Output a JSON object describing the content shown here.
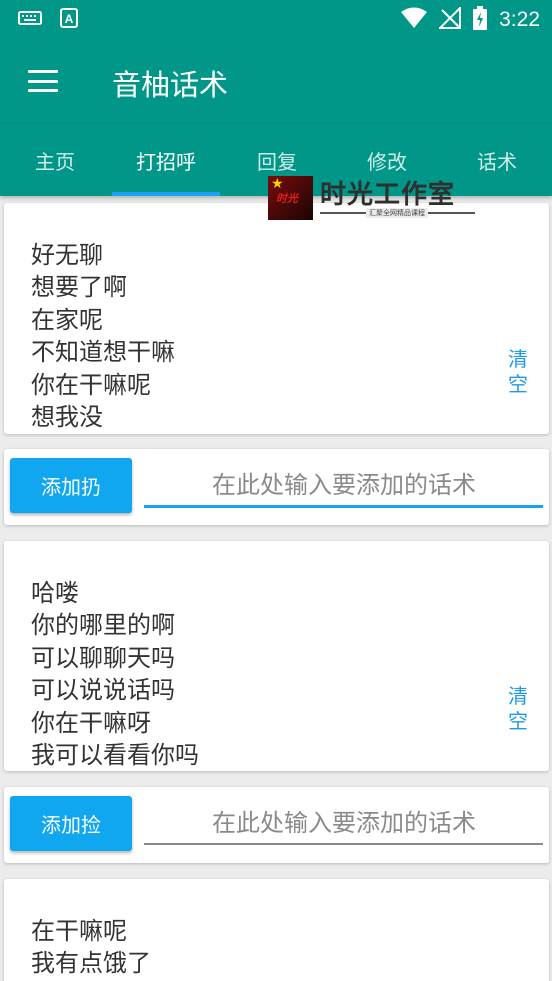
{
  "status_bar": {
    "time": "3:22",
    "keyboard_icon": "keyboard-icon",
    "a_icon": "a-notification-icon",
    "wifi_icon": "wifi-icon",
    "signal_icon": "no-signal-icon",
    "battery_icon": "battery-charging-icon"
  },
  "app_bar": {
    "title": "音柚话术",
    "menu_icon": "menu-icon"
  },
  "tabs": [
    {
      "label": "主页"
    },
    {
      "label": "打招呼"
    },
    {
      "label": "回复"
    },
    {
      "label": "修改"
    },
    {
      "label": "话术"
    }
  ],
  "active_tab": 1,
  "watermark": {
    "title": "时光工作室",
    "subtitle": "汇聚全网精品课程"
  },
  "groups": [
    {
      "phrases": [
        "好无聊",
        "想要了啊",
        "在家呢",
        "不知道想干嘛",
        "你在干嘛呢",
        "想我没"
      ],
      "clear_label_1": "清",
      "clear_label_2": "空",
      "add_button": "添加扔",
      "input_placeholder": "在此处输入要添加的话术"
    },
    {
      "phrases": [
        "哈喽",
        "你的哪里的啊",
        "可以聊聊天吗",
        "可以说说话吗",
        "你在干嘛呀",
        "我可以看看你吗"
      ],
      "clear_label_1": "清",
      "clear_label_2": "空",
      "add_button": "添加捡",
      "input_placeholder": "在此处输入要添加的话术"
    },
    {
      "phrases": [
        "在干嘛呢",
        "我有点饿了"
      ]
    }
  ],
  "colors": {
    "primary": "#009688",
    "accent": "#1aa3f2",
    "button": "#10a7f0",
    "clear_text": "#1e9be8"
  }
}
